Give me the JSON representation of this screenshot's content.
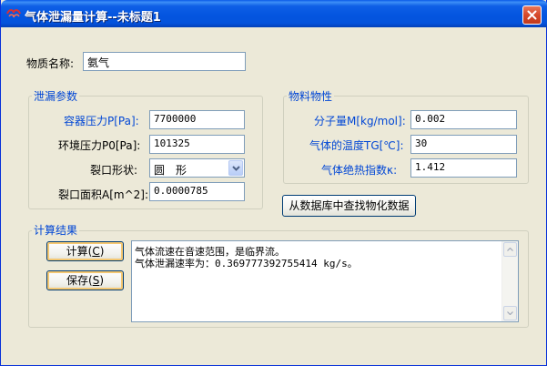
{
  "window": {
    "title": "气体泄漏量计算--未标题1"
  },
  "substance": {
    "label": "物质名称:",
    "value": "氨气"
  },
  "leak_params": {
    "group_title": "泄漏参数",
    "vessel_pressure_label": "容器压力P[Pa]:",
    "vessel_pressure_value": "7700000",
    "ambient_pressure_label": "环境压力P0[Pa]:",
    "ambient_pressure_value": "101325",
    "crack_shape_label": "裂口形状:",
    "crack_shape_value": "圆　形",
    "crack_area_label": "裂口面积A[m^2]:",
    "crack_area_value": "0.0000785"
  },
  "material_props": {
    "group_title": "物料物性",
    "molecular_weight_label": "分子量M[kg/mol]:",
    "molecular_weight_value": "0.002",
    "gas_temp_label": "气体的温度TG[℃]:",
    "gas_temp_value": "30",
    "adiabatic_index_label": "气体绝热指数κ:",
    "adiabatic_index_value": "1.412"
  },
  "lookup_button": "从数据库中查找物化数据",
  "results": {
    "group_title": "计算结果",
    "calc_button": "计算",
    "calc_hotkey": "C",
    "save_button": "保存",
    "save_hotkey": "S",
    "lines": [
      "气体流速在音速范围，是临界流。",
      "气体泄漏速率为：0.369777392755414 kg/s。"
    ]
  },
  "colors": {
    "title_bar": "#0455e0",
    "group_title": "#0046d5",
    "window_bg": "#ece9d8"
  },
  "icons": {
    "title_icon": "app-icon",
    "close_icon": "close-icon",
    "dropdown_icon": "chevron-down-icon"
  }
}
